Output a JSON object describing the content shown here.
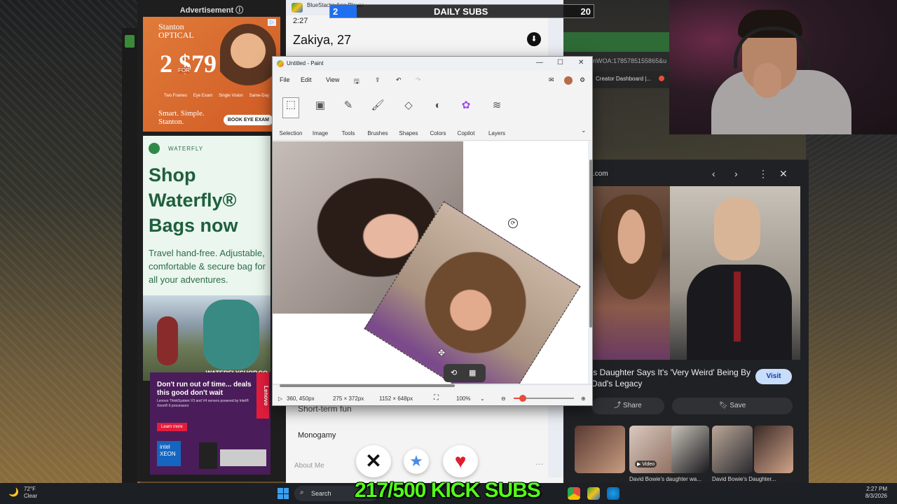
{
  "advert": {
    "label": "Advertisement ⓘ",
    "stanton": {
      "brand1": "Stanton",
      "brand2": "OPTICAL",
      "price": "2 $79",
      "for_label": "FOR",
      "features": [
        "Two Frames",
        "Eye Exam",
        "Single Vision",
        "Same-Day"
      ],
      "slogan1": "Smart. Simple.",
      "slogan2": "Stanton.",
      "cta": "BOOK EYE EXAM"
    },
    "waterfly": {
      "name": "WATERFLY",
      "headline": "Shop Waterfly® Bags now",
      "body": "Travel hand-free. Adjustable, comfortable & secure bag for all your adventures.",
      "site": "WATERFLYSHOP.CO"
    },
    "lenovo": {
      "headline": "Don't run out of time... deals this good don't wait",
      "body": "Lenovo ThinkSystem V3 and V4 servers powered by Intel® Xeon® 6 processors",
      "cta": "Learn more",
      "brand": "Lenovo",
      "intel": "intel XEON"
    }
  },
  "bluestacks": {
    "title": "BlueStacks App Player",
    "status_time": "2:27",
    "profile_name": "Zakiya, 27",
    "short_term": "Short-term fun",
    "monogamy": "Monogamy",
    "about": "About Me",
    "nope": "✕",
    "super": "★",
    "like": "♥"
  },
  "daily_subs": {
    "current": "2",
    "label": "DAILY SUBS",
    "goal": "20",
    "progress": 0.1
  },
  "browser": {
    "url": "nWOA:1785785155865&u",
    "tab": "Creator Dashboard |..."
  },
  "paint": {
    "title": "Untitled - Paint",
    "menu": [
      "File",
      "Edit",
      "View"
    ],
    "tools": [
      "Selection",
      "Image",
      "Tools",
      "Brushes",
      "Shapes",
      "Colors",
      "Copilot",
      "Layers"
    ],
    "cursor_pos": "360, 450px",
    "selection_size": "275 × 372px",
    "canvas_size": "1152 × 648px",
    "zoom": "100%"
  },
  "gimages": {
    "source": ".com",
    "caption": "'s Daughter Says It's 'Very Weird' Being By Dad's Legacy",
    "visit": "Visit",
    "share": "Share",
    "save": "Save",
    "video_badge": "▶ Video",
    "related": [
      "David Bowie's daughter wa...",
      "David Bowie's Daughter..."
    ]
  },
  "taskbar": {
    "temp": "72°F",
    "weather": "Clear",
    "search": "Search",
    "time": "2:27 PM",
    "date": "8/3/2026"
  },
  "kick_subs": "217/500 KICK SUBS"
}
